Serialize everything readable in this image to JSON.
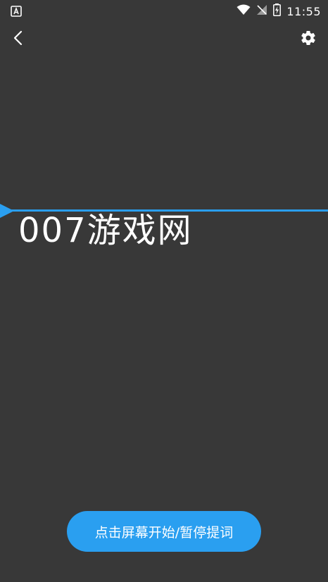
{
  "status_bar": {
    "time": "11:55",
    "left_icon": "a-notification-icon",
    "icons": [
      "wifi-icon",
      "signal-off-icon",
      "battery-charging-icon"
    ]
  },
  "toolbar": {
    "back_icon": "chevron-left-icon",
    "settings_icon": "gear-icon"
  },
  "prompter": {
    "script_text": "007游戏网",
    "line_color": "#2a9ff0"
  },
  "controls": {
    "start_pause_label": "点击屏幕开始/暂停提词",
    "button_color": "#2a9ff0"
  },
  "theme": {
    "background": "#383838",
    "text": "#ffffff"
  }
}
